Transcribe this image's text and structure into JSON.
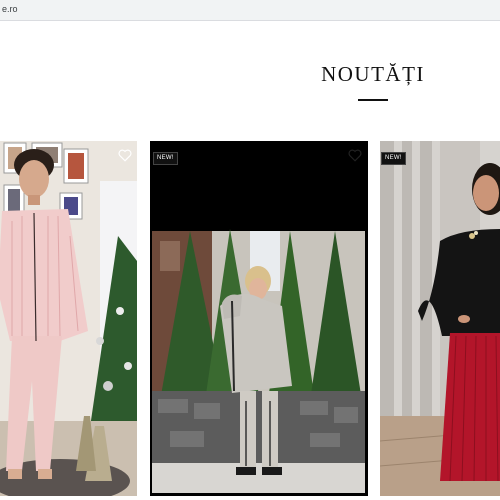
{
  "browser": {
    "url": "e.ro"
  },
  "section": {
    "title": "NOUTĂȚI"
  },
  "products": [
    {
      "image": "woman-pink-striped-pajamas-photo",
      "badge": "",
      "favorite_icon": "heart-icon"
    },
    {
      "image": "woman-grey-hoodie-tracksuit-photo",
      "badge": "NEW!",
      "favorite_icon": "heart-icon"
    },
    {
      "image": "woman-black-top-red-pleated-skirt-photo",
      "badge": "NEW!",
      "favorite_icon": "heart-icon"
    }
  ],
  "colors": {
    "text": "#111111",
    "badge_bg": "#111111",
    "background": "#ffffff"
  }
}
